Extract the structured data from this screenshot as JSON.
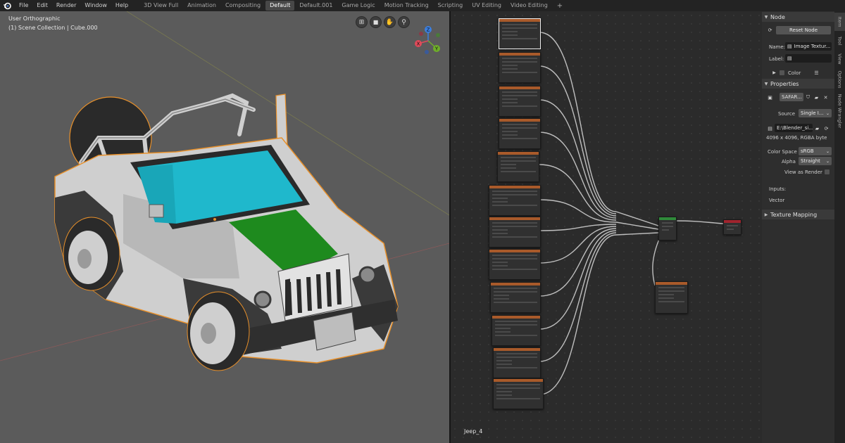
{
  "topbar": {
    "menu": [
      "File",
      "Edit",
      "Render",
      "Window",
      "Help"
    ],
    "workspaces": [
      {
        "label": "3D View Full",
        "active": false
      },
      {
        "label": "Animation",
        "active": false
      },
      {
        "label": "Compositing",
        "active": false
      },
      {
        "label": "Default",
        "active": true
      },
      {
        "label": "Default.001",
        "active": false
      },
      {
        "label": "Game Logic",
        "active": false
      },
      {
        "label": "Motion Tracking",
        "active": false
      },
      {
        "label": "Scripting",
        "active": false
      },
      {
        "label": "UV Editing",
        "active": false
      },
      {
        "label": "Video Editing",
        "active": false
      }
    ],
    "add_tab": "+"
  },
  "viewport": {
    "view_name": "User Orthographic",
    "collection": "(1) Scene Collection | Cube.000",
    "gizmo": {
      "x": "X",
      "y": "Y",
      "z": "Z"
    },
    "colors": {
      "background": "#5b5b5b",
      "body": "#cfcfcf",
      "glass": "#1fb8cc",
      "hood_stripe": "#1e8a1e",
      "outline": "#e8902a",
      "tire": "#2a2a2a"
    }
  },
  "node_editor": {
    "material_name": "Jeep_4",
    "colors": {
      "image_header": "#a95a2a",
      "output_header": "#a0242e",
      "bsdf_header": "#2f8a3a",
      "wire": "#cfcfcf"
    }
  },
  "sidebar": {
    "node_section": "Node",
    "reset_node": "Reset Node",
    "name_label": "Name:",
    "name_value": "Image Textur...",
    "label_label": "Label:",
    "label_value": "",
    "color_label": "Color",
    "properties_section": "Properties",
    "image_name": "SAFAR...",
    "source_label": "Source",
    "source_value": "Single I...",
    "filepath": "E:\\Blender_si...",
    "resolution": "4096 x 4096,  RGBA byte",
    "color_space_label": "Color Space",
    "color_space_value": "sRGB",
    "alpha_label": "Alpha",
    "alpha_value": "Straight",
    "view_as_render": "View as Render",
    "inputs_label": "Inputs:",
    "vector_label": "Vector",
    "texture_mapping": "Texture Mapping"
  },
  "side_tabs": [
    "Item",
    "Tool",
    "View",
    "Options",
    "Node Wrangler"
  ]
}
